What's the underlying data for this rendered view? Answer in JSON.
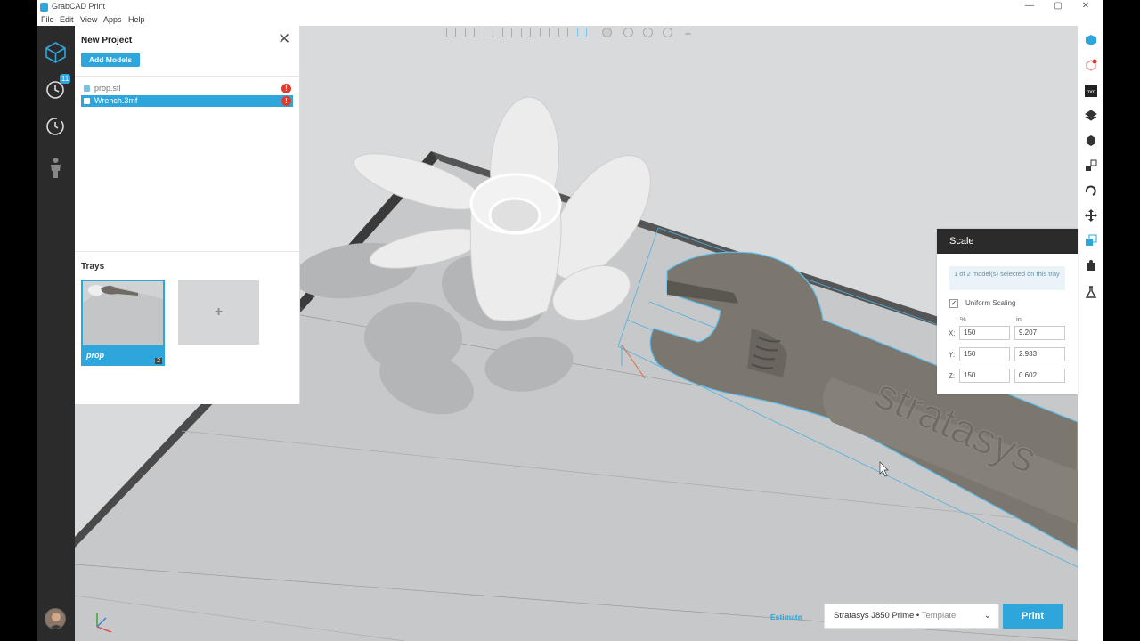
{
  "app": {
    "title": "GrabCAD Print"
  },
  "window_controls": {
    "minimize": "—",
    "maximize": "▢",
    "close": "✕"
  },
  "menu": [
    "File",
    "Edit",
    "View",
    "Apps",
    "Help"
  ],
  "nav": {
    "jobs_badge": "11"
  },
  "project": {
    "title": "New Project",
    "add_models": "Add Models",
    "files": [
      {
        "name": "prop.stl",
        "selected": false
      },
      {
        "name": "Wrench.3mf",
        "selected": true
      }
    ]
  },
  "trays": {
    "label": "Trays",
    "items": [
      {
        "name": "prop",
        "model_count": "2"
      }
    ],
    "add_symbol": "+"
  },
  "scale_panel": {
    "title": "Scale",
    "info": "1 of 2 model(s) selected on this tray",
    "uniform_label": "Uniform Scaling",
    "uniform_checked": "✓",
    "unit_percent": "%",
    "unit_in": "in",
    "x_label": "X:",
    "y_label": "Y:",
    "z_label": "Z:",
    "x_pct": "150",
    "x_in": "9.207",
    "y_pct": "150",
    "y_in": "2.933",
    "z_pct": "150",
    "z_in": "0.602"
  },
  "model_text": "stratasys",
  "bottom": {
    "estimate": "Estimate",
    "printer": "Stratasys J850 Prime",
    "printer_sep": " • ",
    "printer_mode": "Template",
    "print": "Print"
  },
  "colors": {
    "accent": "#2ea6dc",
    "warning": "#e03b2e",
    "nav_bg": "#2b2b2b"
  }
}
